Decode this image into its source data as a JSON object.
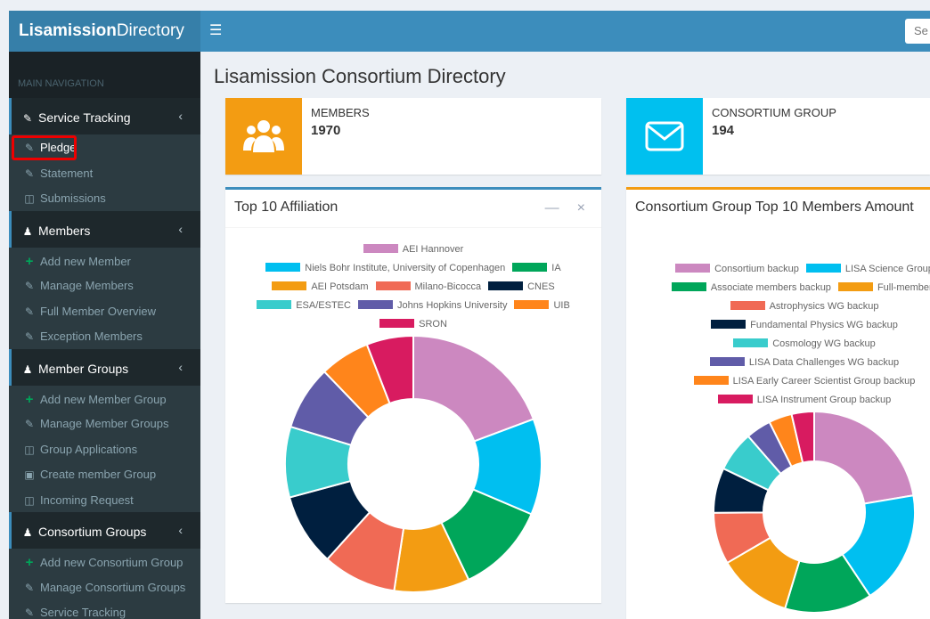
{
  "header": {
    "logo_bold": "Lisamission",
    "logo_rest": "Directory",
    "search_placeholder": "Se"
  },
  "sidebar": {
    "nav_header": "MAIN NAVIGATION",
    "service_tracking": {
      "label": "Service Tracking",
      "items": [
        "Pledge",
        "Statement",
        "Submissions"
      ]
    },
    "members": {
      "label": "Members",
      "items": [
        "Add new Member",
        "Manage Members",
        "Full Member Overview",
        "Exception Members"
      ]
    },
    "member_groups": {
      "label": "Member Groups",
      "items": [
        "Add new Member Group",
        "Manage Member Groups",
        "Group Applications",
        "Create member Group",
        "Incoming Request"
      ]
    },
    "consortium_groups": {
      "label": "Consortium Groups",
      "items": [
        "Add new Consortium Group",
        "Manage Consortium Groups",
        "Service Tracking"
      ]
    }
  },
  "main": {
    "title": "Lisamission Consortium Directory",
    "members_box": {
      "label": "MEMBERS",
      "value": "1970",
      "color": "#f39c12"
    },
    "consortium_box": {
      "label": "CONSORTIUM GROUP",
      "value": "194",
      "color": "#00c0ef"
    },
    "affiliation_panel": {
      "title": "Top 10 Affiliation",
      "border_color": "#3c8dbc"
    },
    "consortium_panel": {
      "title": "Consortium Group Top 10 Members Amount",
      "border_color": "#f39c12"
    }
  },
  "chart_data": [
    {
      "type": "pie",
      "title": "Top 10 Affiliation",
      "categories": [
        "AEI Hannover",
        "Niels Bohr Institute, University of Copenhagen",
        "IA",
        "AEI Potsdam",
        "Milano-Bicocca",
        "CNES",
        "ESA/ESTEC",
        "Johns Hopkins University",
        "UIB",
        "SRON"
      ],
      "values": [
        19.3,
        12.1,
        11.5,
        9.5,
        9.3,
        9.1,
        8.9,
        8.1,
        6.3,
        5.9
      ],
      "colors": [
        "#cc88c0",
        "#00bff0",
        "#00a65a",
        "#f39c12",
        "#f06a55",
        "#001f3f",
        "#39cccc",
        "#605ca8",
        "#ff851b",
        "#d81b60"
      ],
      "legend_position": "top"
    },
    {
      "type": "pie",
      "title": "Consortium Group Top 10 Members Amount",
      "categories": [
        "Consortium backup",
        "LISA Science Group",
        "Associate members backup",
        "Full-members",
        "Astrophysics WG backup",
        "Fundamental Physics WG backup",
        "Cosmology WG backup",
        "LISA Data Challenges WG backup",
        "LISA Early Career Scientist Group backup",
        "LISA Instrument Group backup"
      ],
      "legend_labels": [
        "Consortium backup",
        "LISA Science Group",
        "Associate members backup",
        "Full-members",
        "Astrophysics WG backup",
        "Fundamental Physics WG backup",
        "Cosmology WG backup",
        "LISA Data Challenges WG backup",
        "LISA Early Career Scientist Group backup",
        "LISA Instrument Group backup"
      ],
      "values": [
        21.0,
        17.2,
        13.2,
        11.2,
        7.8,
        6.8,
        6.1,
        3.8,
        3.5,
        3.4
      ],
      "colors": [
        "#cc88c0",
        "#00bff0",
        "#00a65a",
        "#f39c12",
        "#f06a55",
        "#001f3f",
        "#39cccc",
        "#605ca8",
        "#ff851b",
        "#d81b60"
      ],
      "legend_position": "top"
    }
  ]
}
